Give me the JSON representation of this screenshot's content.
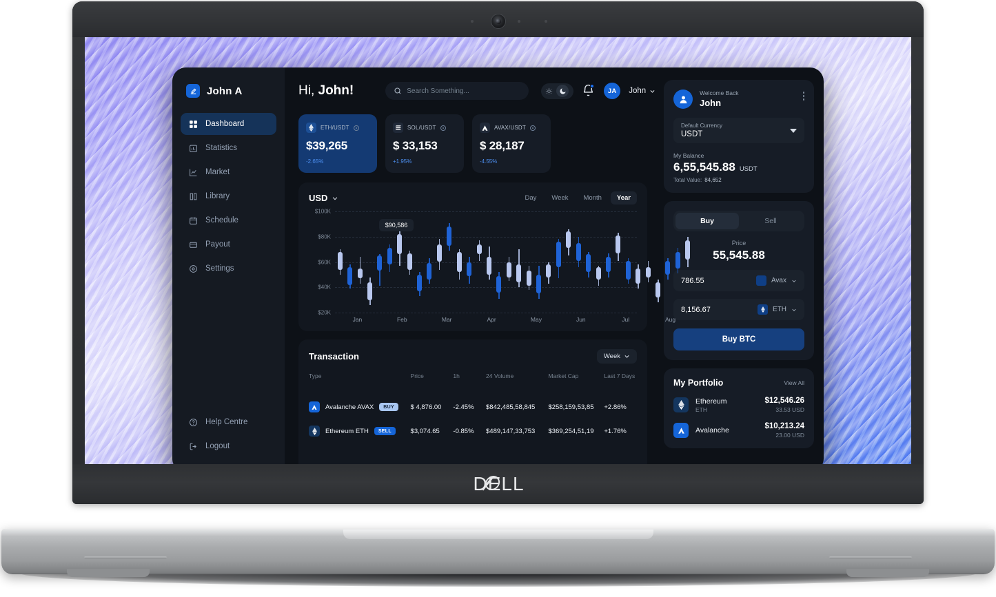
{
  "device": {
    "brand": "DELL"
  },
  "sidebar": {
    "brand_name": "John A",
    "items": [
      {
        "label": "Dashboard",
        "icon": "grid-icon"
      },
      {
        "label": "Statistics",
        "icon": "chart-bar-icon"
      },
      {
        "label": "Market",
        "icon": "trending-up-icon"
      },
      {
        "label": "Library",
        "icon": "book-icon"
      },
      {
        "label": "Schedule",
        "icon": "calendar-icon"
      },
      {
        "label": "Payout",
        "icon": "wallet-icon"
      },
      {
        "label": "Settings",
        "icon": "gear-icon"
      }
    ],
    "bottom_items": [
      {
        "label": "Help Centre",
        "icon": "question-circle-icon"
      },
      {
        "label": "Logout",
        "icon": "logout-icon"
      }
    ]
  },
  "header": {
    "greeting_prefix": "Hi, ",
    "greeting_name": "John!",
    "search_placeholder": "Search Something...",
    "search_value": "",
    "theme": "dark",
    "avatar_initials": "JA",
    "user_name": "John"
  },
  "tickers": [
    {
      "pair": "ETH/USDT",
      "price": "$39,265",
      "change": "-2.65%",
      "selected": true,
      "icon": "ethereum-icon"
    },
    {
      "pair": "SOL/USDT",
      "price": "$ 33,153",
      "change": "+1.95%",
      "selected": false,
      "icon": "solana-icon"
    },
    {
      "pair": "AVAX/USDT",
      "price": "$ 28,187",
      "change": "-4.55%",
      "selected": false,
      "icon": "avalanche-icon"
    }
  ],
  "chart_panel": {
    "currency": "USD",
    "ranges": [
      "Day",
      "Week",
      "Month",
      "Year"
    ],
    "active_range": "Year",
    "tooltip": "$90,586"
  },
  "chart_data": {
    "type": "candlestick",
    "title": "USD",
    "xlabel": "",
    "ylabel": "",
    "ylim": [
      20000,
      100000
    ],
    "ytick_labels": [
      "$100K",
      "$80K",
      "$60K",
      "$40K",
      "$20K"
    ],
    "ytick_values": [
      100000,
      80000,
      60000,
      40000,
      20000
    ],
    "xtick_labels": [
      "Jan",
      "Feb",
      "Mar",
      "Apr",
      "May",
      "Jun",
      "Jul",
      "Aug"
    ],
    "grid": true,
    "legend": "none",
    "annotation": {
      "text": "$90,586",
      "near_index": 6
    },
    "colors": {
      "light": "#b9c8ef",
      "dark": "#1f63d6"
    },
    "candles": [
      {
        "low": 50000,
        "open": 54000,
        "close": 68000,
        "high": 70000,
        "color": "light"
      },
      {
        "low": 39000,
        "open": 42000,
        "close": 56000,
        "high": 58000,
        "color": "dark"
      },
      {
        "low": 43000,
        "open": 47000,
        "close": 55000,
        "high": 64000,
        "color": "light"
      },
      {
        "low": 26000,
        "open": 30000,
        "close": 44000,
        "high": 48000,
        "color": "light"
      },
      {
        "low": 41000,
        "open": 53000,
        "close": 65000,
        "high": 66000,
        "color": "dark"
      },
      {
        "low": 52000,
        "open": 58000,
        "close": 71000,
        "high": 74000,
        "color": "dark"
      },
      {
        "low": 57000,
        "open": 66000,
        "close": 82000,
        "high": 84000,
        "color": "light"
      },
      {
        "low": 50000,
        "open": 54000,
        "close": 67000,
        "high": 69000,
        "color": "light"
      },
      {
        "low": 33000,
        "open": 37000,
        "close": 50000,
        "high": 52000,
        "color": "dark"
      },
      {
        "low": 43000,
        "open": 46000,
        "close": 59000,
        "high": 63000,
        "color": "dark"
      },
      {
        "low": 54000,
        "open": 60000,
        "close": 74000,
        "high": 78000,
        "color": "light"
      },
      {
        "low": 69000,
        "open": 73000,
        "close": 88000,
        "high": 91000,
        "color": "dark"
      },
      {
        "low": 46000,
        "open": 52000,
        "close": 68000,
        "high": 70000,
        "color": "light"
      },
      {
        "low": 43000,
        "open": 49000,
        "close": 60000,
        "high": 64000,
        "color": "dark"
      },
      {
        "low": 61000,
        "open": 66000,
        "close": 74000,
        "high": 77000,
        "color": "light"
      },
      {
        "low": 46000,
        "open": 50000,
        "close": 64000,
        "high": 72000,
        "color": "light"
      },
      {
        "low": 31000,
        "open": 36000,
        "close": 49000,
        "high": 52000,
        "color": "dark"
      },
      {
        "low": 45000,
        "open": 48000,
        "close": 60000,
        "high": 64000,
        "color": "light"
      },
      {
        "low": 40000,
        "open": 44000,
        "close": 58000,
        "high": 70000,
        "color": "light"
      },
      {
        "low": 38000,
        "open": 41000,
        "close": 53000,
        "high": 57000,
        "color": "light"
      },
      {
        "low": 31000,
        "open": 35000,
        "close": 50000,
        "high": 57000,
        "color": "dark"
      },
      {
        "low": 43000,
        "open": 48000,
        "close": 58000,
        "high": 60000,
        "color": "light"
      },
      {
        "low": 47000,
        "open": 56000,
        "close": 76000,
        "high": 78000,
        "color": "dark"
      },
      {
        "low": 65000,
        "open": 71000,
        "close": 84000,
        "high": 86000,
        "color": "light"
      },
      {
        "low": 56000,
        "open": 61000,
        "close": 75000,
        "high": 80000,
        "color": "dark"
      },
      {
        "low": 48000,
        "open": 52000,
        "close": 66000,
        "high": 68000,
        "color": "dark"
      },
      {
        "low": 41000,
        "open": 46000,
        "close": 56000,
        "high": 57000,
        "color": "light"
      },
      {
        "low": 48000,
        "open": 52000,
        "close": 64000,
        "high": 67000,
        "color": "dark"
      },
      {
        "low": 61000,
        "open": 67000,
        "close": 81000,
        "high": 83000,
        "color": "light"
      },
      {
        "low": 43000,
        "open": 46000,
        "close": 61000,
        "high": 63000,
        "color": "dark"
      },
      {
        "low": 39000,
        "open": 43000,
        "close": 55000,
        "high": 58000,
        "color": "light"
      },
      {
        "low": 44000,
        "open": 48000,
        "close": 56000,
        "high": 61000,
        "color": "light"
      },
      {
        "low": 28000,
        "open": 32000,
        "close": 44000,
        "high": 46000,
        "color": "light"
      },
      {
        "low": 46000,
        "open": 50000,
        "close": 61000,
        "high": 63000,
        "color": "dark"
      },
      {
        "low": 51000,
        "open": 55000,
        "close": 68000,
        "high": 71000,
        "color": "dark"
      },
      {
        "low": 56000,
        "open": 62000,
        "close": 77000,
        "high": 80000,
        "color": "light"
      }
    ]
  },
  "transaction": {
    "title": "Transaction",
    "period": "Week",
    "columns": [
      "Type",
      "Price",
      "1h",
      "24 Volume",
      "Market Cap",
      "Last 7 Days"
    ],
    "rows": [
      {
        "name": "Avalanche AVAX",
        "badge": "BUY",
        "badge_type": "buy",
        "icon": "avalanche-icon",
        "price": "$ 4,876.00",
        "h1": "-2.45%",
        "volume": "$842,485,58,845",
        "market_cap": "$258,159,53,85",
        "last7": "+2.86%"
      },
      {
        "name": "Ethereum ETH",
        "badge": "SELL",
        "badge_type": "sell",
        "icon": "ethereum-icon",
        "price": "$3,074.65",
        "h1": "-0.85%",
        "volume": "$489,147,33,753",
        "market_cap": "$369,254,51,19",
        "last7": "+1.76%"
      }
    ]
  },
  "welcome": {
    "small": "Welcome Back",
    "name": "John",
    "currency_label": "Default Currency",
    "currency_value": "USDT",
    "balance_label": "My Balance",
    "balance_value": "6,55,545.88",
    "balance_unit": "USDT",
    "total_label": "Total Value:",
    "total_value": "84,652"
  },
  "trade": {
    "tabs": [
      "Buy",
      "Sell"
    ],
    "active_tab": "Buy",
    "price_label": "Price",
    "price_value": "55,545.88",
    "amount_1": "786.55",
    "currency_1": "Avax",
    "amount_2": "8,156.67",
    "currency_2": "ETH",
    "action_label": "Buy BTC"
  },
  "portfolio": {
    "title": "My Portfolio",
    "view_all": "View All",
    "items": [
      {
        "name": "Ethereum",
        "symbol": "ETH",
        "amount": "$12,546.26",
        "usd": "33.53 USD",
        "icon": "ethereum-icon"
      },
      {
        "name": "Avalanche",
        "symbol": "",
        "amount": "$10,213.24",
        "usd": "23.00 USD",
        "icon": "avalanche-icon"
      }
    ]
  },
  "colors": {
    "accent": "#1565d8",
    "accent_dark": "#16407f",
    "panel": "#161c26",
    "app_bg": "#0d1117",
    "candle_light": "#b9c8ef",
    "candle_dark": "#1f63d6",
    "change_blue": "#4d8ff0"
  }
}
